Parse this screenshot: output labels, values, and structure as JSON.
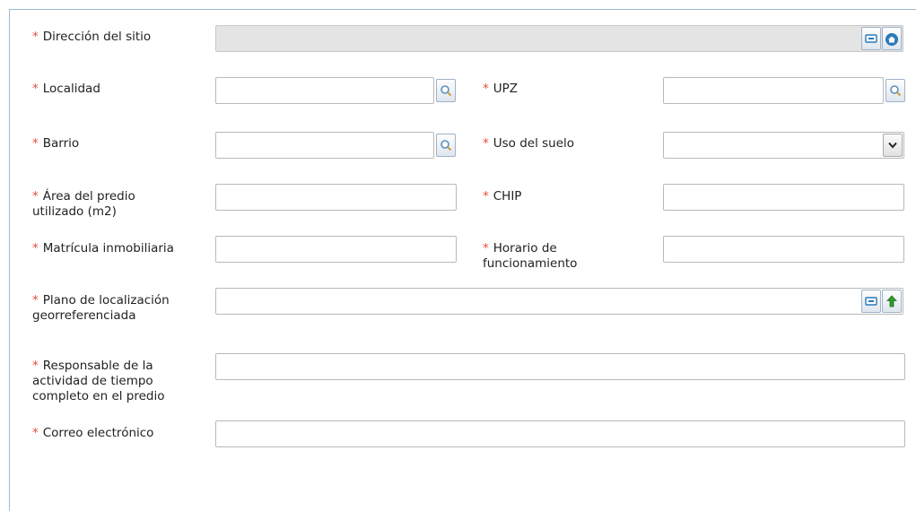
{
  "form": {
    "required_mark": "*",
    "direccion": {
      "label": "Dirección del sitio",
      "value": ""
    },
    "localidad": {
      "label": "Localidad",
      "value": ""
    },
    "upz": {
      "label": "UPZ",
      "value": ""
    },
    "barrio": {
      "label": "Barrio",
      "value": ""
    },
    "uso_suelo": {
      "label": "Uso del suelo",
      "selected": ""
    },
    "area": {
      "label_line1": "Área del predio",
      "label_line2": "utilizado (m2)",
      "value": ""
    },
    "chip": {
      "label": "CHIP",
      "value": ""
    },
    "matricula": {
      "label": "Matrícula inmobiliaria",
      "value": ""
    },
    "horario": {
      "label_line1": "Horario de",
      "label_line2": "funcionamiento",
      "value": ""
    },
    "plano": {
      "label_line1": "Plano de localización",
      "label_line2": "georreferenciada",
      "value": ""
    },
    "responsable": {
      "label_line1": "Responsable de la",
      "label_line2": "actividad de tiempo",
      "label_line3": "completo en el predio",
      "value": ""
    },
    "correo": {
      "label": "Correo electrónico",
      "value": ""
    }
  },
  "icons": {
    "search": "magnifier-icon",
    "minus": "minus-icon",
    "home": "home-icon",
    "upload": "up-arrow-icon",
    "dropdown": "chevron-down-icon"
  },
  "colors": {
    "required": "#e84c3d",
    "border": "#b9b9b9",
    "disabled_bg": "#e4e4e4",
    "frame": "#9dbad3",
    "icon_blue": "#2a7ab8",
    "icon_green": "#2e9a2e"
  }
}
